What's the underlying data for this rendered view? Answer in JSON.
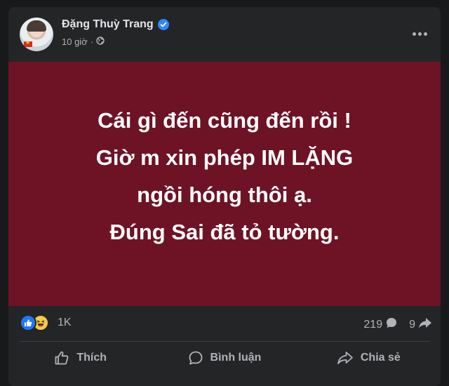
{
  "post": {
    "author": "Đặng Thuỳ Trang",
    "time": "10 giờ",
    "separator": "·",
    "text_lines": [
      "Cái gì đến cũng đến rồi !",
      "Giờ m xin phép IM LẶNG",
      "ngồi hóng thôi ạ.",
      "Đúng Sai đã tỏ tường."
    ],
    "background_color": "#6d1325",
    "reactions": {
      "count": "1K",
      "types": [
        "like-icon",
        "haha-icon"
      ]
    },
    "comments_count": "219",
    "shares_count": "9"
  },
  "actions": {
    "like_label": "Thích",
    "comment_label": "Bình luận",
    "share_label": "Chia sẻ"
  },
  "theme": {
    "page_bg": "#18191a",
    "card_bg": "#242526",
    "text_primary": "#e4e6eb",
    "text_secondary": "#b0b3b8",
    "accent": "#2d88ff"
  }
}
